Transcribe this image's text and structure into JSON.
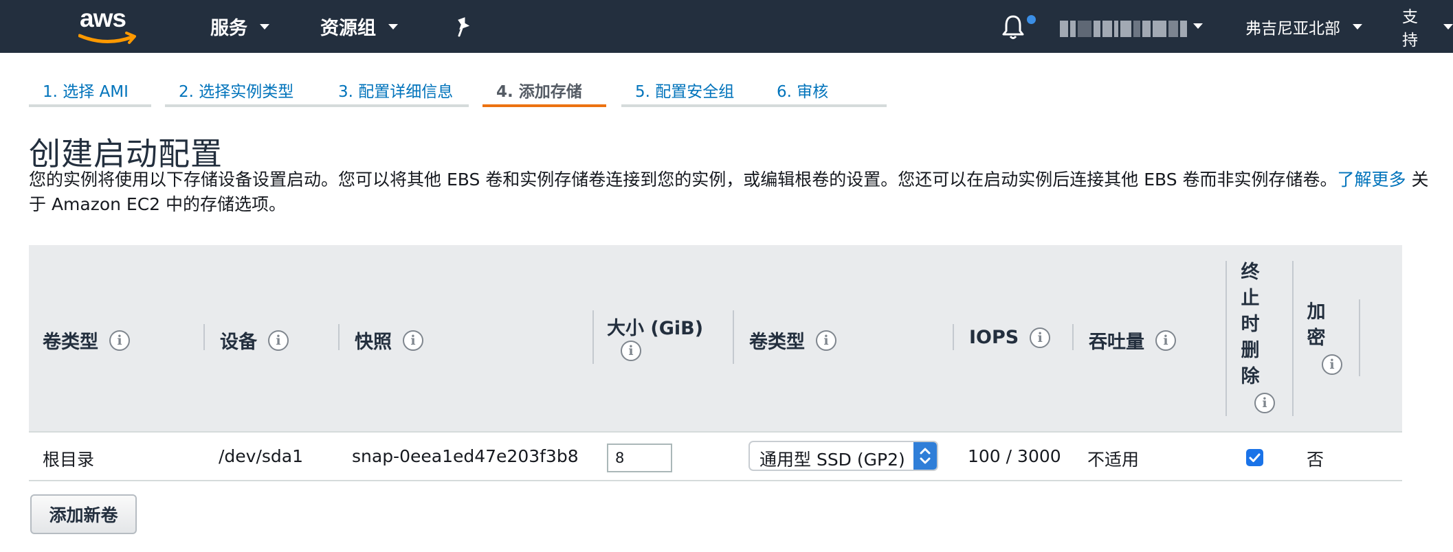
{
  "nav": {
    "logo": "aws",
    "services": "服务",
    "resource_groups": "资源组",
    "region": "弗吉尼亚北部",
    "support": "支持",
    "icons": [
      "pin-icon",
      "bell-icon"
    ],
    "accent": "#ec7211"
  },
  "tabs": [
    {
      "label": "1. 选择 AMI"
    },
    {
      "label": "2. 选择实例类型"
    },
    {
      "label": "3. 配置详细信息"
    },
    {
      "label": "4. 添加存储",
      "active": true
    },
    {
      "label": "5. 配置安全组"
    },
    {
      "label": "6. 审核"
    }
  ],
  "page": {
    "title": "创建启动配置",
    "desc_main": "您的实例将使用以下存储设备设置启动。您可以将其他 EBS 卷和实例存储卷连接到您的实例，或编辑根卷的设置。您还可以在启动实例后连接其他 EBS 卷而非实例存储卷。",
    "learn_more": "了解更多",
    "desc_tail": " 关于 Amazon EC2 中的存储选项。"
  },
  "table": {
    "headers": {
      "volume": "卷类型",
      "device": "设备",
      "snapshot": "快照",
      "size": "大小 (GiB)",
      "volume_type": "卷类型",
      "iops": "IOPS",
      "throughput": "吞吐量",
      "delete_on_term": "终止时删除",
      "encrypted": "加密"
    },
    "delete_on_term_chars": [
      "终",
      "止",
      "时",
      "删",
      "除"
    ],
    "encrypted_chars": [
      "加",
      "密"
    ],
    "info_glyph": "i",
    "row": {
      "volume": "根目录",
      "device": "/dev/sda1",
      "snapshot": "snap-0eea1ed47e203f3b8",
      "size": "8",
      "volume_type": "通用型 SSD (GP2)",
      "iops": "100 / 3000",
      "throughput": "不适用",
      "delete_on_term": true,
      "encrypted": "否"
    }
  },
  "add_volume": "添加新卷"
}
